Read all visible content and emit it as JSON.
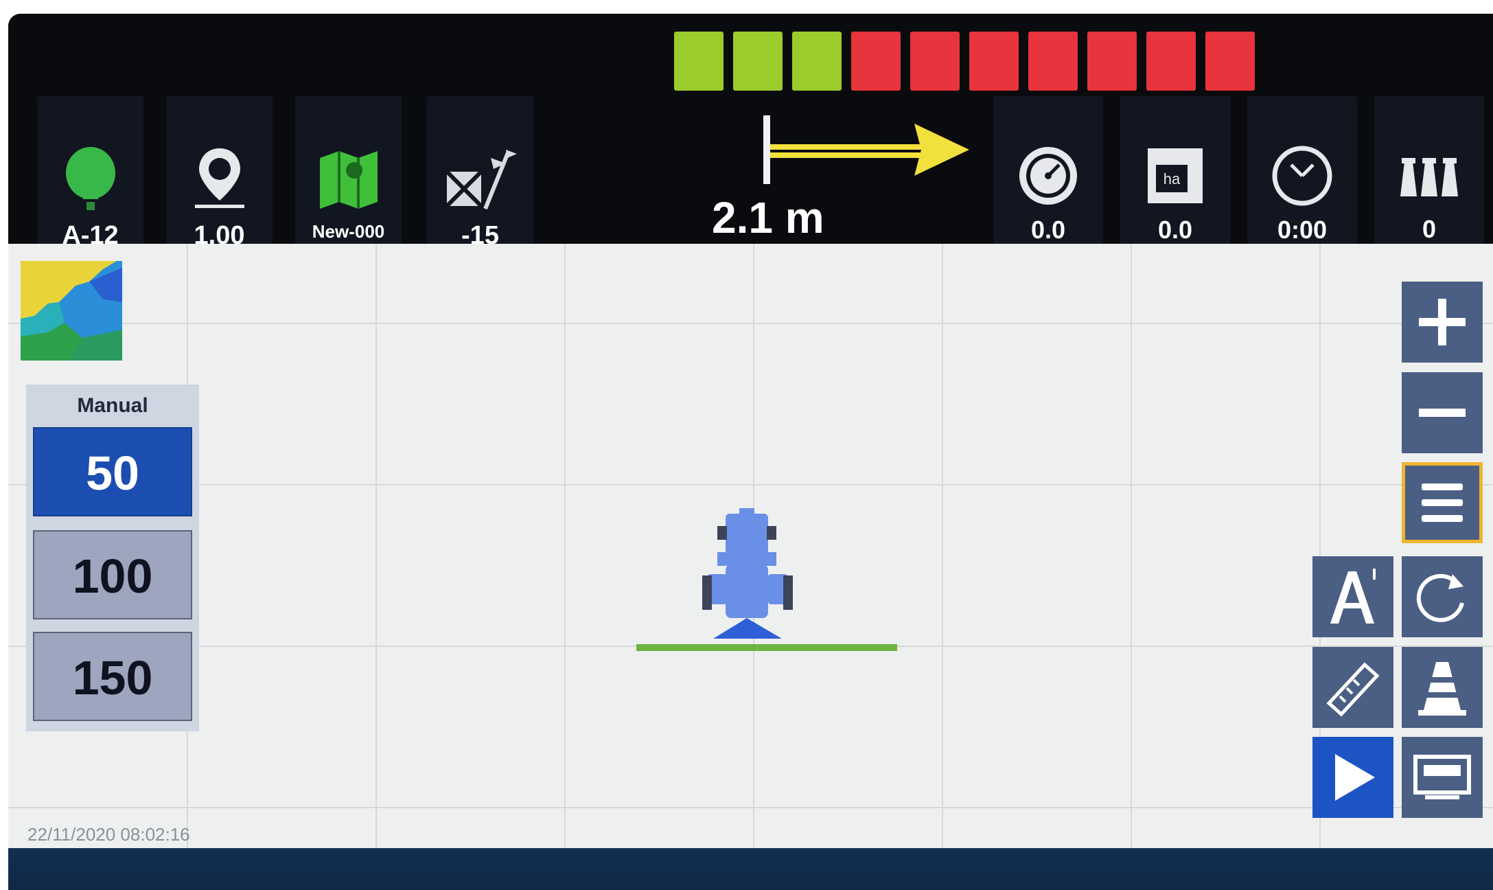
{
  "signal_bar": {
    "segments": [
      "green",
      "green",
      "green",
      "red",
      "red",
      "red",
      "red",
      "red",
      "red",
      "red"
    ],
    "colors": {
      "green": "#9ccb2c",
      "red": "#e8343c"
    }
  },
  "top_tiles": [
    {
      "icon": "gnss-balloon-icon",
      "value": "A-12"
    },
    {
      "icon": "location-pin-icon",
      "value": "1.00"
    },
    {
      "icon": "field-map-icon",
      "value": "New-000"
    },
    {
      "icon": "guidance-line-icon",
      "value": "-15"
    }
  ],
  "guidance": {
    "distance": "2.1 m",
    "arrow_color": "#f2e03c"
  },
  "right_tiles": [
    {
      "icon": "speed-gauge-icon",
      "value": "0.0"
    },
    {
      "icon": "area-ha-icon",
      "value": "0.0",
      "icon_text": "ha"
    },
    {
      "icon": "clock-icon",
      "value": "0:00"
    },
    {
      "icon": "sections-icon",
      "value": "0"
    }
  ],
  "rate_panel": {
    "mode_label": "Manual",
    "rates": [
      "50",
      "100",
      "150"
    ],
    "selected": "50"
  },
  "datetime": "22/11/2020 08:02:16",
  "side_buttons": [
    {
      "name": "zoom-in-button",
      "icon": "plus-icon"
    },
    {
      "name": "zoom-out-button",
      "icon": "minus-icon"
    },
    {
      "name": "menu-button",
      "icon": "hamburger-icon"
    },
    {
      "name": "ab-line-button",
      "icon": "a-plus-icon"
    },
    {
      "name": "rotate-view-button",
      "icon": "rotate-icon"
    },
    {
      "name": "ruler-button",
      "icon": "ruler-icon"
    },
    {
      "name": "cone-button",
      "icon": "cone-icon"
    },
    {
      "name": "play-button",
      "icon": "play-icon"
    },
    {
      "name": "display-button",
      "icon": "display-icon"
    }
  ],
  "colors": {
    "accent": "#1c4eb2",
    "grass": "#6db33f",
    "tractor": "#6a8fe6"
  }
}
